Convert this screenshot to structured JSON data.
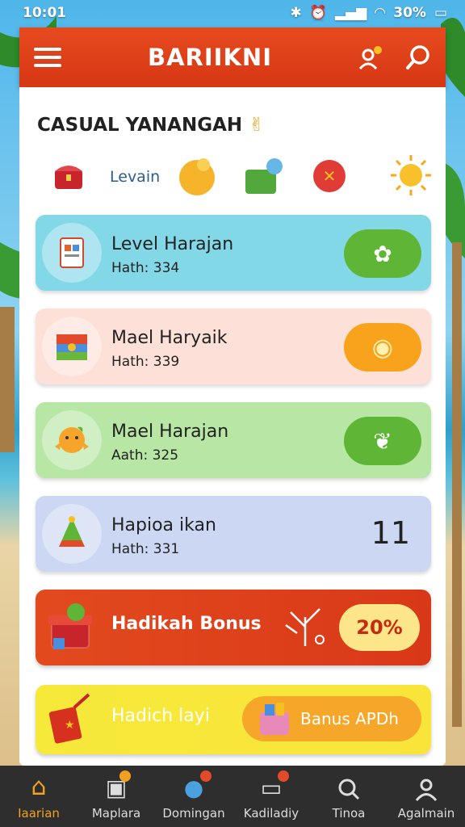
{
  "status_bar": {
    "time": "10:01",
    "battery": "30%"
  },
  "header": {
    "title": "BARIIKNI"
  },
  "page": {
    "title": "CASUAL YANANGAH",
    "category_label": "Levain"
  },
  "rows": [
    {
      "name": "Level Harajan",
      "sub": "Hath: 334",
      "bg": "#83d8e8",
      "btn_color": "#5fb636"
    },
    {
      "name": "Mael Haryaik",
      "sub": "Hath: 339",
      "bg": "#fde0d8",
      "btn_color": "#f9a21c"
    },
    {
      "name": "Mael Harajan",
      "sub": "Aath: 325",
      "bg": "#b7e6a5",
      "btn_color": "#5fb636"
    },
    {
      "name": "Hapioa ikan",
      "sub": "Hath: 331",
      "bg": "#ccd8f3",
      "value": "11"
    }
  ],
  "bonus": {
    "label": "Hadikah Bonus",
    "pill": "20%"
  },
  "daily": {
    "label": "Hadich layi",
    "button": "Banus APDh"
  },
  "nav": [
    {
      "label": "Iaarian",
      "active": true
    },
    {
      "label": "Maplara"
    },
    {
      "label": "Domingan"
    },
    {
      "label": "Kadiladiy"
    },
    {
      "label": "Tinoa"
    },
    {
      "label": "Agalmain"
    }
  ]
}
